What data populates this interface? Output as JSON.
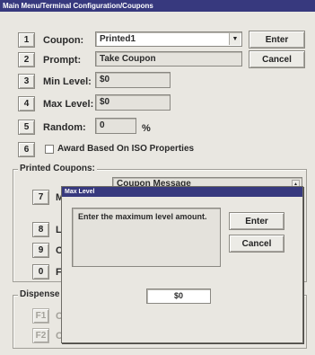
{
  "window": {
    "title": "Main Menu/Terminal Configuration/Coupons"
  },
  "buttons": {
    "enter": "Enter",
    "cancel": "Cancel"
  },
  "rows": [
    {
      "num": "1",
      "label": "Coupon:",
      "value": "Printed1"
    },
    {
      "num": "2",
      "label": "Prompt:",
      "value": "Take Coupon"
    },
    {
      "num": "3",
      "label": "Min Level:",
      "value": "$0"
    },
    {
      "num": "4",
      "label": "Max Level:",
      "value": "$0"
    },
    {
      "num": "5",
      "label": "Random:",
      "value": "0",
      "unit": "%"
    },
    {
      "num": "6",
      "label": "Award Based On ISO Properties"
    }
  ],
  "printed_coupons": {
    "title": "Printed Coupons:",
    "column_header": "Coupon Message",
    "rows": [
      {
        "num": "7",
        "label_fragment": "M"
      },
      {
        "num": "8",
        "label_fragment": "L"
      },
      {
        "num": "9",
        "label_fragment": "C"
      },
      {
        "num": "0",
        "label_fragment": "F"
      }
    ]
  },
  "dispensed": {
    "title": "Dispense",
    "rows": [
      {
        "num": "F1",
        "label_fragment": "C"
      },
      {
        "num": "F2",
        "label_fragment": "C"
      }
    ]
  },
  "dialog": {
    "title": "Max Level",
    "message": "Enter the maximum level amount.",
    "enter": "Enter",
    "cancel": "Cancel",
    "value": "$0"
  },
  "icons": {
    "dropdown": "chevron-down-icon",
    "scroll": "scroll-arrow-icon"
  }
}
